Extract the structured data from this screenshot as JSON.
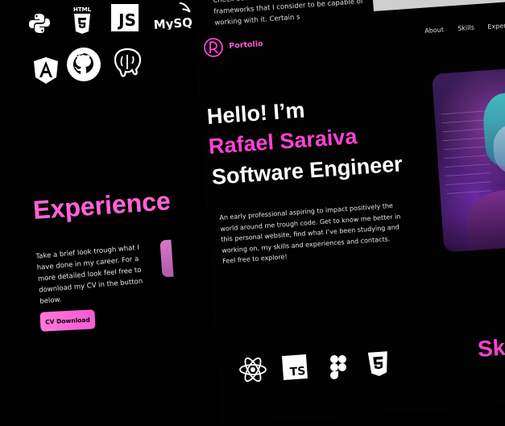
{
  "top_text": "Check out a list of my skills, tools and frameworks that I consider to be capable of working with it. Certain s",
  "brand": {
    "name": "Portolio",
    "accent": "#ff42d4"
  },
  "nav": {
    "items": [
      "About",
      "Skills",
      "Exper"
    ]
  },
  "hero": {
    "greeting": "Hello! I’m",
    "name": "Rafael Saraiva",
    "role": "Software Engineer",
    "intro": "An early professional aspiring to impact positively the world around me trough code.  Get to know me better in this personal website, find what I’ve been studying and working on, my skills and experiences and contacts. Feel free to explore!"
  },
  "experience": {
    "title": "Experience",
    "text": "Take a brief look trough what I have done in my career. For a more detailed look feel free to download my CV in the button below.",
    "cv_button": "CV Download"
  },
  "skills_section": {
    "title_partial": "Sk"
  },
  "left_icons": {
    "python": "python-icon",
    "html": "HTML",
    "html_number": "5",
    "js": "JS",
    "mysql": "MySQL",
    "angular": "angular-icon",
    "github": "github-icon",
    "postgres": "postgresql-icon"
  },
  "bottom_icons": {
    "react": "react-icon",
    "ts": "TS",
    "figma": "figma-icon",
    "html5": "5"
  },
  "colors": {
    "background": "#000000",
    "accent": "#ff42d4",
    "button": "#f45bd3"
  }
}
